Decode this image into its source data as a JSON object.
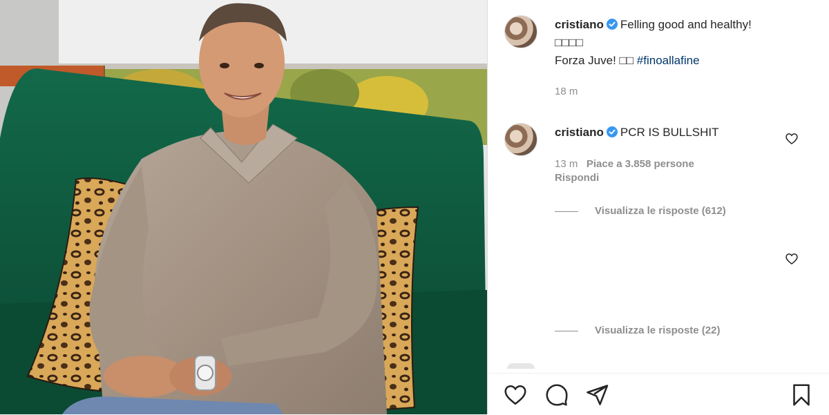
{
  "post": {
    "caption": {
      "username": "cristiano",
      "text_line1": "Felling good and healthy!",
      "text_line2": "□□□□",
      "text_line3_prefix": "Forza Juve! □□ ",
      "hashtag": "#finoallafine",
      "time": "18 m"
    },
    "comments": [
      {
        "username": "cristiano",
        "text": "PCR IS BULLSHIT",
        "time": "13 m",
        "likes": "Piace a 3.858 persone",
        "reply_label": "Rispondi",
        "view_replies": "Visualizza le risposte (612)"
      },
      {
        "view_replies": "Visualizza le risposte (22)"
      }
    ]
  },
  "icons": {
    "verified": "verified-badge-icon",
    "like": "heart-icon",
    "comment": "comment-icon",
    "share": "send-icon",
    "save": "bookmark-icon"
  },
  "colors": {
    "verified": "#3897f0",
    "hashtag": "#00376b",
    "muted": "#8e8e8e",
    "text": "#262626",
    "sofa": "#0f5a3c"
  }
}
